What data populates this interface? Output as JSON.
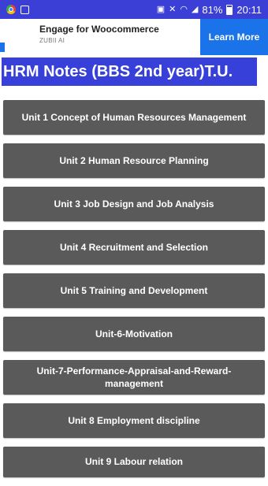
{
  "status_bar": {
    "battery": "81%",
    "time": "20:11",
    "icons": [
      "chrome-icon",
      "notification-square-icon",
      "nfc-icon",
      "mute-icon",
      "wifi-icon",
      "signal-icon",
      "battery-icon"
    ]
  },
  "ad": {
    "title": "Engage for Woocommerce",
    "subtitle": "ZUBII AI",
    "cta": "Learn More"
  },
  "page": {
    "title": "HRM Notes (BBS 2nd year)T.U."
  },
  "units": [
    "Unit 1 Concept of Human Resources Management",
    "Unit 2 Human Resource Planning",
    "Unit 3 Job Design and Job Analysis",
    "Unit 4 Recruitment and Selection",
    "Unit 5 Training and Development",
    "Unit-6-Motivation",
    "Unit-7-Performance-Appraisal-and-Reward-management",
    "Unit 8 Employment discipline",
    "Unit 9 Labour relation"
  ],
  "colors": {
    "status_bar": "#3b3fd6",
    "title_bg": "#3740d9",
    "button_bg": "#5a5a5a",
    "ad_cta": "#1a73e8"
  }
}
